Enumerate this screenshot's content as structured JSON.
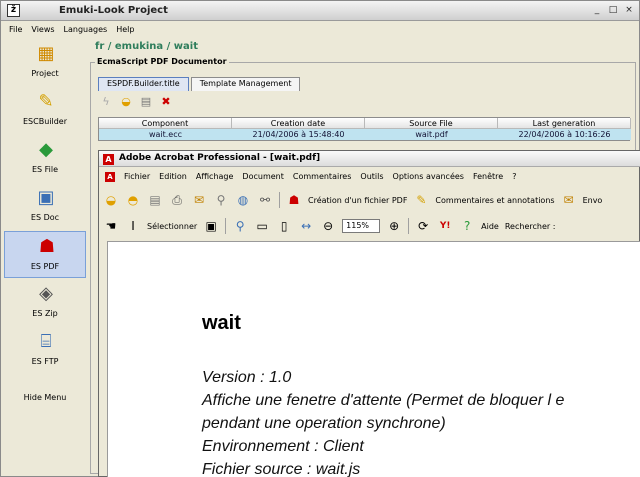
{
  "window": {
    "title": "Emuki-Look Project",
    "controls": [
      "_",
      "□",
      "×"
    ]
  },
  "menu": [
    "File",
    "Views",
    "Languages",
    "Help"
  ],
  "sidebar": {
    "items": [
      {
        "label": "Project",
        "icon": "project-icon"
      },
      {
        "label": "ESCBuilder",
        "icon": "pencil-icon"
      },
      {
        "label": "ES File",
        "icon": "file-icon"
      },
      {
        "label": "ES Doc",
        "icon": "doc-icon"
      },
      {
        "label": "ES PDF",
        "icon": "pdf-icon",
        "active": true
      },
      {
        "label": "ES Zip",
        "icon": "zip-icon"
      },
      {
        "label": "ES FTP",
        "icon": "ftp-icon"
      }
    ],
    "hide_menu": "Hide Menu"
  },
  "main": {
    "path": "fr / emukina / wait",
    "group_title": "EcmaScript PDF Documentor",
    "tabs": [
      "ESPDF.Builder.title",
      "Template Management"
    ],
    "table": {
      "headers": [
        "Component",
        "Creation date",
        "Source File",
        "Last generation"
      ],
      "row": [
        "wait.ecc",
        "21/04/2006 à 15:48:40",
        "wait.pdf",
        "22/04/2006 à 10:16:26"
      ]
    }
  },
  "acrobat": {
    "title": "Adobe Acrobat Professional - [wait.pdf]",
    "menu": [
      "Fichier",
      "Edition",
      "Affichage",
      "Document",
      "Commentaires",
      "Outils",
      "Options avancées",
      "Fenêtre",
      "?"
    ],
    "toolbar1": {
      "create_pdf": "Création d'un fichier PDF",
      "comments": "Commentaires et annotations",
      "send": "Envo"
    },
    "toolbar2": {
      "select": "Sélectionner",
      "zoom": "115%",
      "help": "Aide",
      "search": "Rechercher :"
    },
    "document": {
      "title": "wait",
      "lines": [
        "Version : 1.0",
        "Affiche une fenetre d'attente (Permet de bloquer l e",
        "pendant une operation synchrone)",
        "Environnement : Client",
        "Fichier source : wait.js"
      ]
    }
  },
  "colors": {
    "path": "#2e7d5b",
    "row_highlight": "#bfe3f0",
    "active_side": "#c8d6ef",
    "acrobat_red": "#cc0000"
  }
}
